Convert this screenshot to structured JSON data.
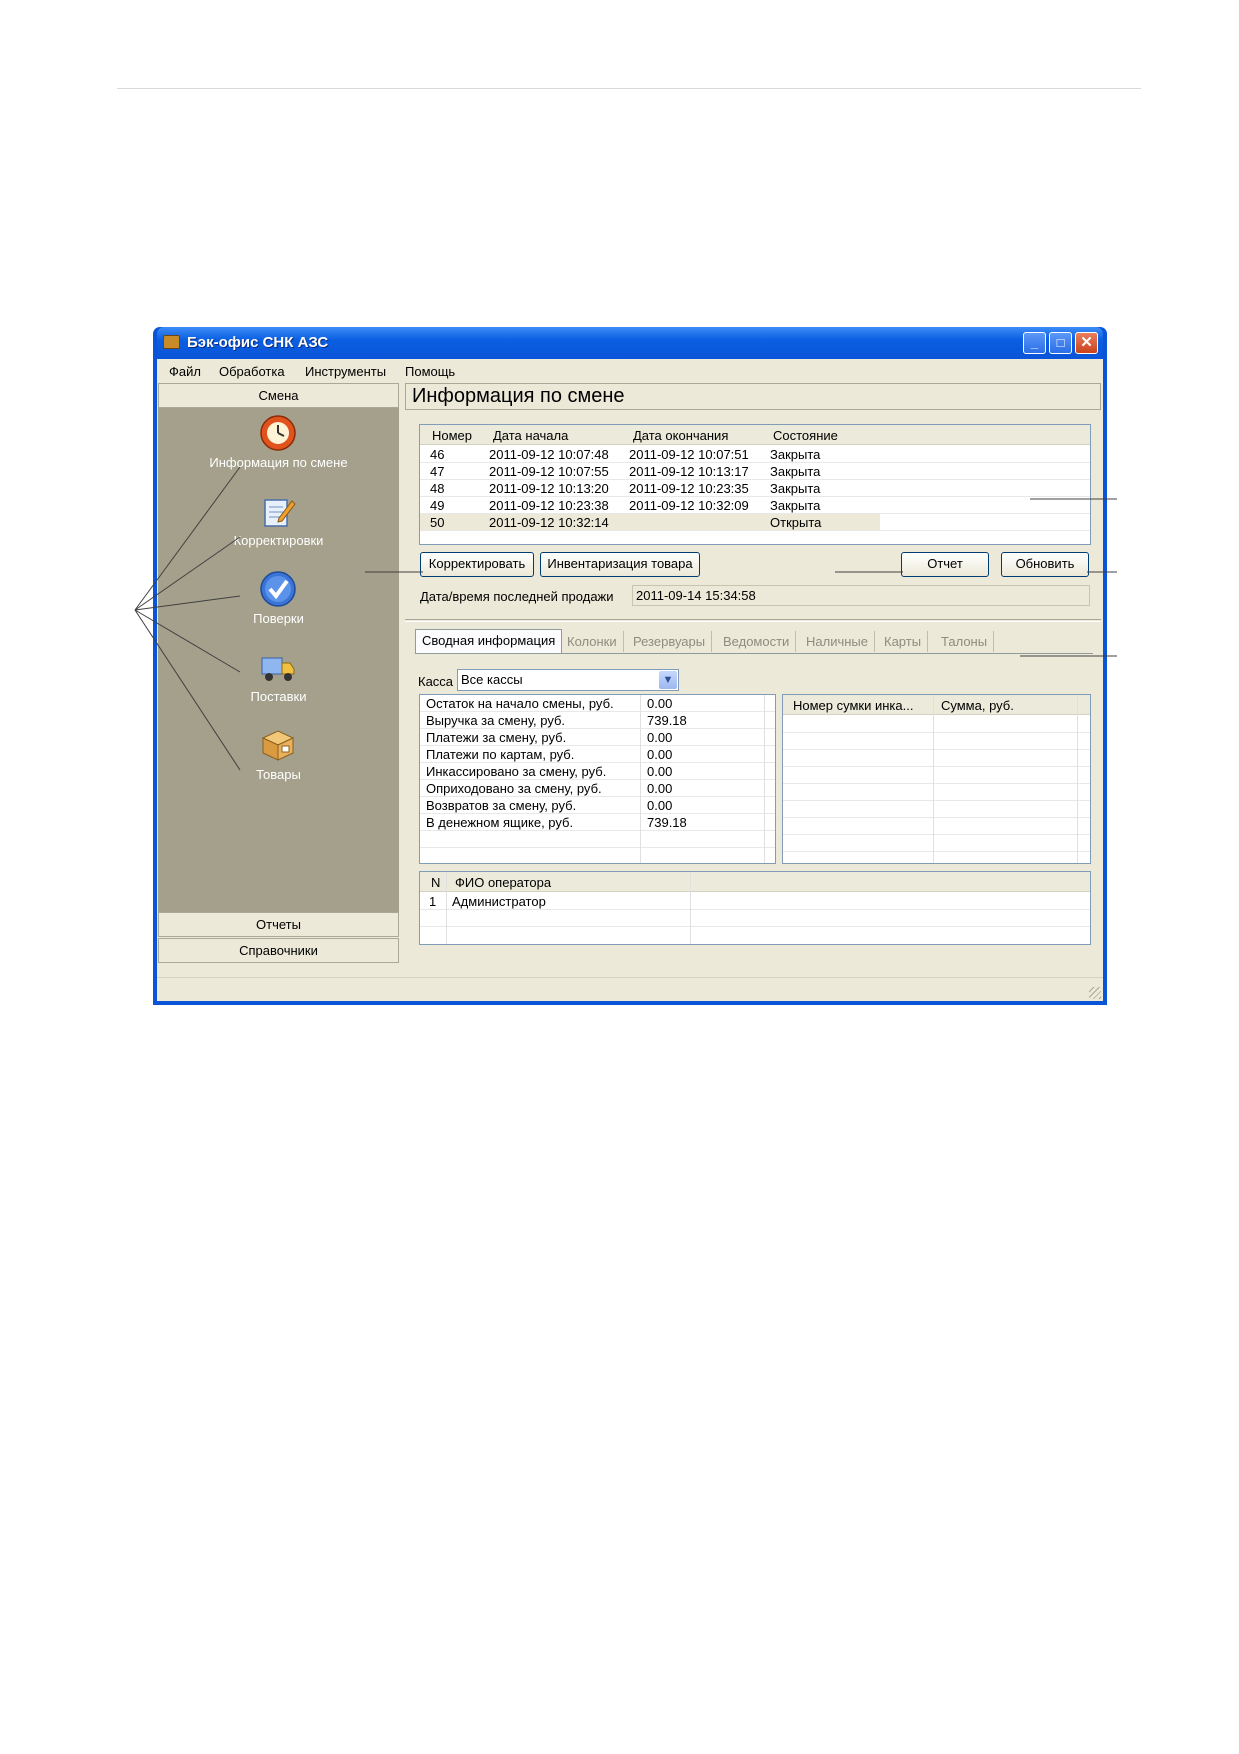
{
  "window": {
    "title": "Бэк-офис СНК АЗС"
  },
  "menu": [
    "Файл",
    "Обработка",
    "Инструменты",
    "Помощь"
  ],
  "sidebar": {
    "groups": {
      "shift": "Смена",
      "reports": "Отчеты",
      "refs": "Справочники"
    },
    "items": [
      {
        "label": "Информация по смене",
        "icon": "clock-icon"
      },
      {
        "label": "Корректировки",
        "icon": "notepad-pencil-icon"
      },
      {
        "label": "Поверки",
        "icon": "checkmark-icon"
      },
      {
        "label": "Поставки",
        "icon": "truck-icon"
      },
      {
        "label": "Товары",
        "icon": "box-icon"
      }
    ]
  },
  "main": {
    "title": "Информация по смене",
    "shifts": {
      "columns": [
        "Номер",
        "Дата начала",
        "Дата окончания",
        "Состояние"
      ],
      "rows": [
        [
          "46",
          "2011-09-12 10:07:48",
          "2011-09-12 10:07:51",
          "Закрыта"
        ],
        [
          "47",
          "2011-09-12 10:07:55",
          "2011-09-12 10:13:17",
          "Закрыта"
        ],
        [
          "48",
          "2011-09-12 10:13:20",
          "2011-09-12 10:23:35",
          "Закрыта"
        ],
        [
          "49",
          "2011-09-12 10:23:38",
          "2011-09-12 10:32:09",
          "Закрыта"
        ],
        [
          "50",
          "2011-09-12 10:32:14",
          "",
          "Открыта"
        ]
      ]
    },
    "buttons": {
      "correct": "Корректировать",
      "inventory": "Инвентаризация товара",
      "report": "Отчет",
      "refresh": "Обновить"
    },
    "last_sale": {
      "label": "Дата/время последней продажи",
      "value": "2011-09-14 15:34:58"
    },
    "tabs": [
      "Сводная информация",
      "Колонки",
      "Резервуары",
      "Ведомости",
      "Наличные",
      "Карты",
      "Талоны"
    ],
    "cashbox": {
      "label": "Касса",
      "value": "Все кассы"
    },
    "summary": [
      [
        "Остаток на начало смены, руб.",
        "0.00"
      ],
      [
        "Выручка за смену, руб.",
        "739.18"
      ],
      [
        "Платежи за смену, руб.",
        "0.00"
      ],
      [
        "Платежи по картам, руб.",
        "0.00"
      ],
      [
        "Инкассировано за смену, руб.",
        "0.00"
      ],
      [
        "Оприходовано за смену, руб.",
        "0.00"
      ],
      [
        "Возвратов за смену, руб.",
        "0.00"
      ],
      [
        "В денежном ящике, руб.",
        "739.18"
      ]
    ],
    "collection": {
      "columns": [
        "Номер сумки инка...",
        "Сумма, руб."
      ]
    },
    "operators": {
      "columns": [
        "N",
        "ФИО оператора"
      ],
      "rows": [
        [
          "1",
          "Администратор"
        ]
      ]
    }
  }
}
